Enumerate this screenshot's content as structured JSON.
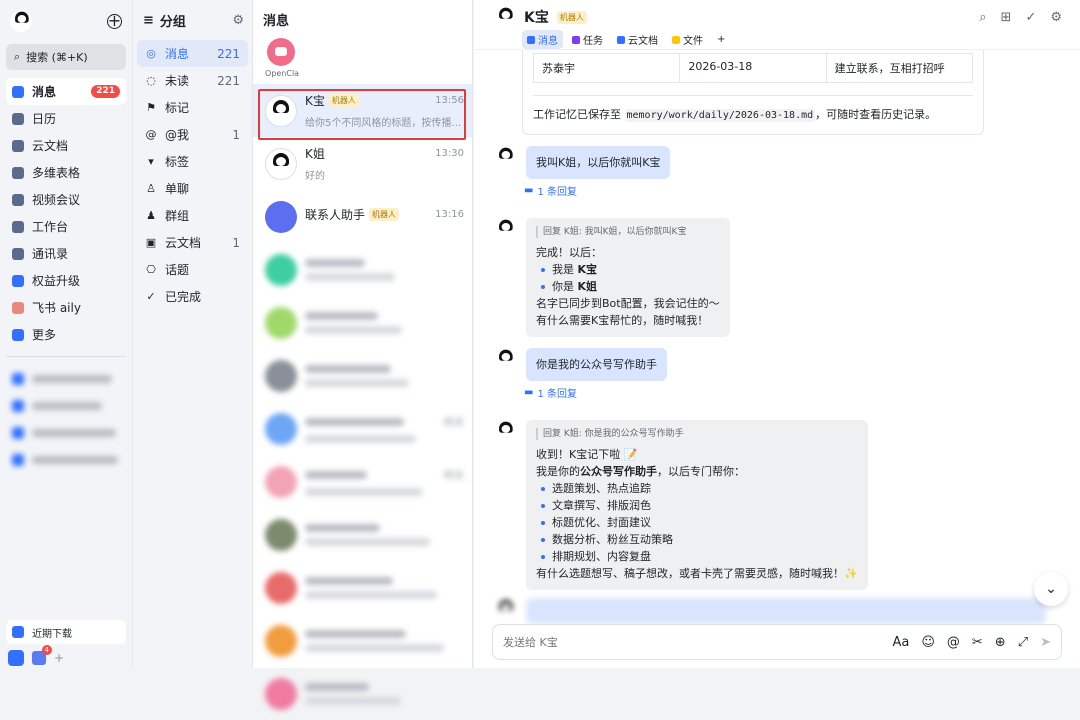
{
  "nav": {
    "search_label": "搜索 (⌘+K)",
    "items": [
      {
        "label": "消息",
        "badge": "221",
        "color": "#3370ff"
      },
      {
        "label": "日历",
        "color": "#5b6b8c"
      },
      {
        "label": "云文档",
        "color": "#5b6b8c"
      },
      {
        "label": "多维表格",
        "color": "#5b6b8c"
      },
      {
        "label": "视频会议",
        "color": "#5b6b8c"
      },
      {
        "label": "工作台",
        "color": "#5b6b8c"
      },
      {
        "label": "通讯录",
        "color": "#5b6b8c"
      },
      {
        "label": "权益升级",
        "color": "#3370ff"
      },
      {
        "label": "飞书 aily",
        "color": "#e58a7d"
      },
      {
        "label": "更多",
        "color": "#3370ff"
      }
    ],
    "recent_download": "近期下载",
    "notif_count": "4"
  },
  "groups": {
    "title": "分组",
    "items": [
      {
        "label": "消息",
        "count": "221"
      },
      {
        "label": "未读",
        "count": "221"
      },
      {
        "label": "标记",
        "count": ""
      },
      {
        "label": "@我",
        "count": "1"
      },
      {
        "label": "标签",
        "count": ""
      },
      {
        "label": "单聊",
        "count": ""
      },
      {
        "label": "群组",
        "count": ""
      },
      {
        "label": "云文档",
        "count": "1"
      },
      {
        "label": "话题",
        "count": ""
      },
      {
        "label": "已完成",
        "count": ""
      }
    ]
  },
  "list": {
    "title": "消息",
    "pinned_name": "OpenCla",
    "conversations": [
      {
        "name": "K宝",
        "tag": "机器人",
        "time": "13:56",
        "preview": "给你5个不同风格的标题，按传播性+..."
      },
      {
        "name": "K姐",
        "tag": "",
        "time": "13:30",
        "preview": "好的"
      },
      {
        "name": "联系人助手",
        "tag": "机器人",
        "time": "13:16",
        "preview": ""
      }
    ],
    "blurred_times": [
      "",
      "",
      "",
      "昨天",
      "昨天",
      "",
      "",
      "",
      ""
    ],
    "blurred_snips": [
      "",
      "",
      "",
      "",
      "篇文章",
      "通知",
      "",
      "",
      "",
      "手",
      "过，已发"
    ]
  },
  "chat": {
    "title": "K宝",
    "tag": "机器人",
    "tabs": [
      "消息",
      "任务",
      "云文档",
      "文件"
    ],
    "tab_add": "+",
    "table_row": [
      "苏泰宇",
      "2026-03-18",
      "建立联系，互相打招呼"
    ],
    "memory_prefix": "工作记忆已保存至 ",
    "memory_path": "memory/work/daily/2026-03-18.md",
    "memory_suffix": "，可随时查看历史记录。",
    "msg1": "我叫K姐，以后你就叫K宝",
    "reply_count": "1 条回复",
    "reply1_quote": "回复 K姐: 我叫K姐，以后你就叫K宝",
    "reply1_intro": "完成！以后：",
    "reply1_b1_pre": "我是 ",
    "reply1_b1_strong": "K宝",
    "reply1_b2_pre": "你是 ",
    "reply1_b2_strong": "K姐",
    "reply1_l3": "名字已同步到Bot配置，我会记住的～",
    "reply1_l4": "有什么需要K宝帮忙的，随时喊我！",
    "msg2": "你是我的公众号写作助手",
    "reply2_quote": "回复 K姐: 你是我的公众号写作助手",
    "reply2_l1": "收到！K宝记下啦 📝",
    "reply2_l2_pre": "我是你的",
    "reply2_l2_strong": "公众号写作助手",
    "reply2_l2_post": "，以后专门帮你：",
    "reply2_bullets": [
      "选题策划、热点追踪",
      "文章撰写、排版润色",
      "标题优化、封面建议",
      "数据分析、粉丝互动策略",
      "排期规划、内容复盘"
    ],
    "reply2_end": "有什么选题想写、稿子想改，或者卡壳了需要灵感，随时喊我！✨",
    "input_placeholder": "发送给 K宝"
  }
}
